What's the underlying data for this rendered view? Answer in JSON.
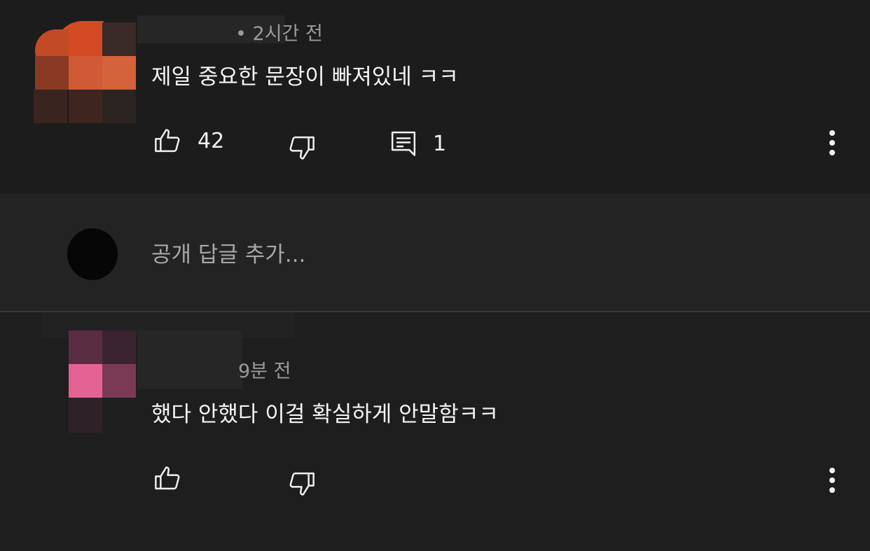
{
  "comments": [
    {
      "time": "2시간 전",
      "text": "제일 중요한 문장이 빠져있네 ㅋㅋ",
      "like_count": "42",
      "reply_count": "1",
      "avatar_color": "#d9542c"
    },
    {
      "time": "9분 전",
      "text": "했다 안했다 이걸 확실하게 안말함ㅋㅋ",
      "like_count": "",
      "reply_count": "",
      "avatar_color": "#e8608e"
    }
  ],
  "reply_box": {
    "placeholder": "공개 답글 추가..."
  },
  "icons": {
    "like": "thumbs-up-icon",
    "dislike": "thumbs-down-icon",
    "reply": "comment-icon",
    "menu": "more-vert-icon"
  },
  "colors": {
    "background": "#1c1c1c",
    "reply_bar": "#232323",
    "text": "#f1f1f1",
    "muted": "#9a9a9a"
  }
}
